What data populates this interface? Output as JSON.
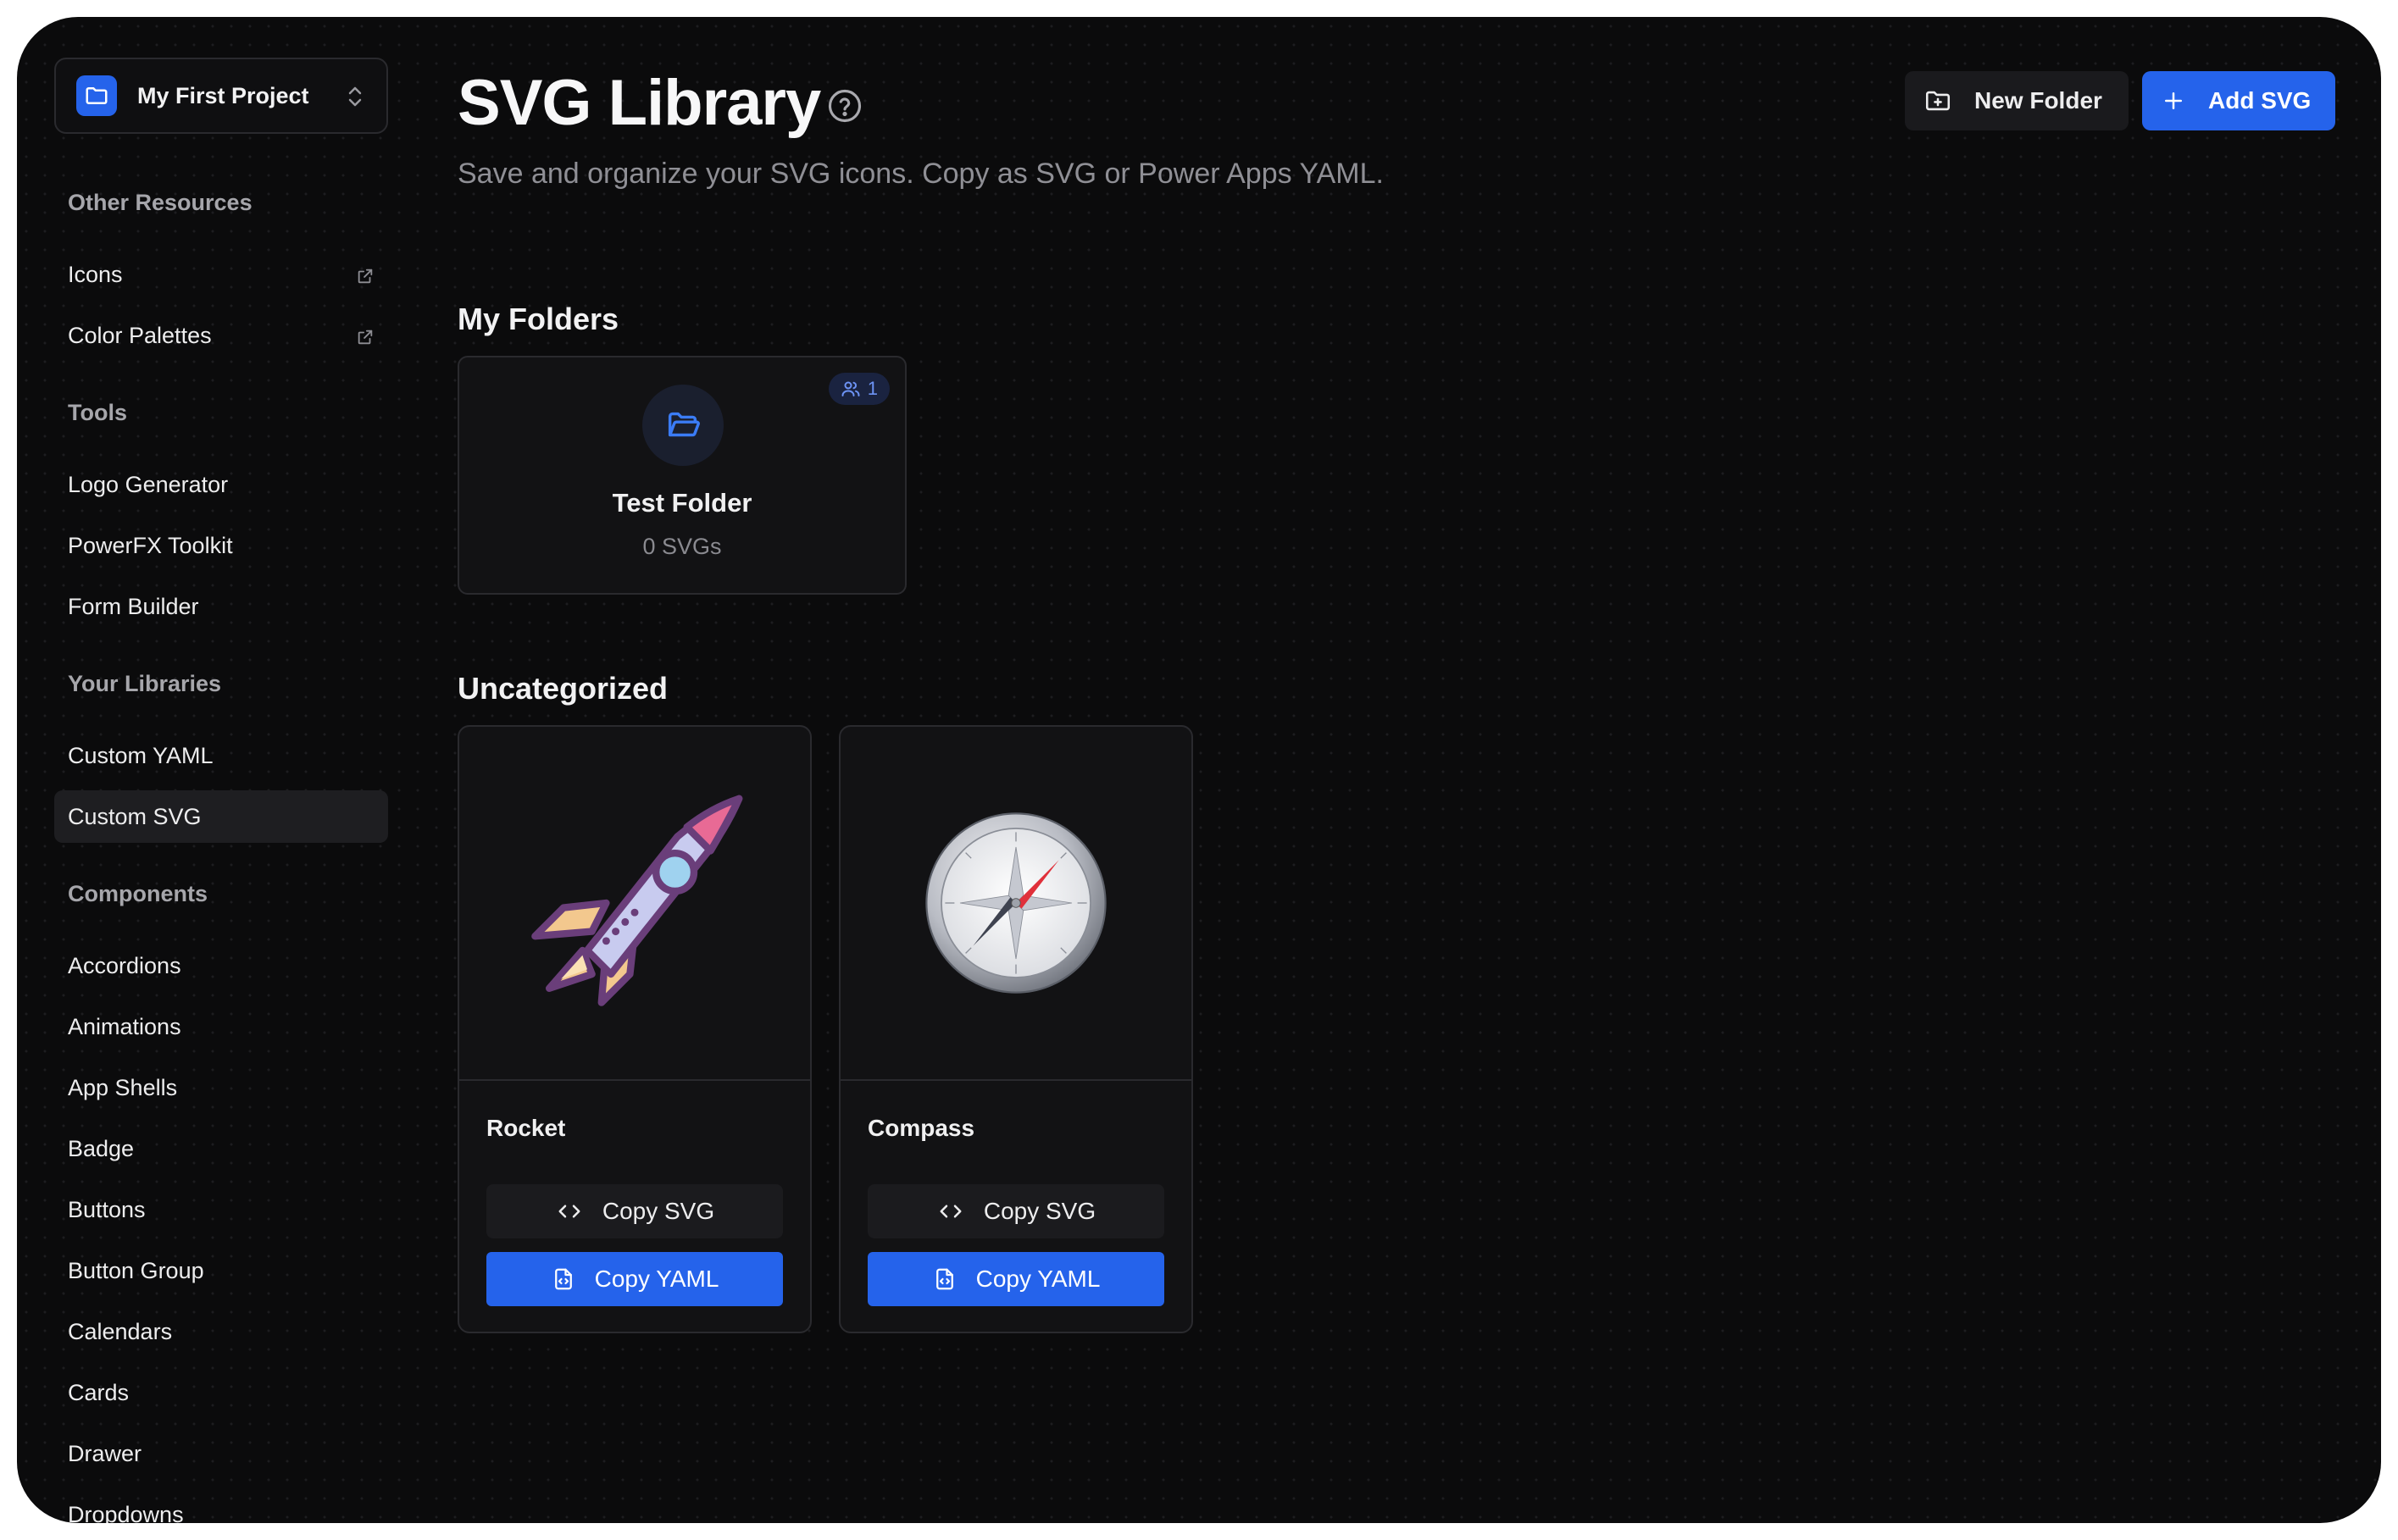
{
  "project": {
    "name": "My First Project"
  },
  "sidebar": {
    "sections": [
      {
        "heading": "Other Resources",
        "items": [
          {
            "label": "Icons",
            "external": true
          },
          {
            "label": "Color Palettes",
            "external": true
          }
        ]
      },
      {
        "heading": "Tools",
        "items": [
          {
            "label": "Logo Generator"
          },
          {
            "label": "PowerFX Toolkit"
          },
          {
            "label": "Form Builder"
          }
        ]
      },
      {
        "heading": "Your Libraries",
        "items": [
          {
            "label": "Custom YAML"
          },
          {
            "label": "Custom SVG",
            "active": true
          }
        ]
      },
      {
        "heading": "Components",
        "items": [
          {
            "label": "Accordions"
          },
          {
            "label": "Animations"
          },
          {
            "label": "App Shells"
          },
          {
            "label": "Badge"
          },
          {
            "label": "Buttons"
          },
          {
            "label": "Button Group"
          },
          {
            "label": "Calendars"
          },
          {
            "label": "Cards"
          },
          {
            "label": "Drawer"
          },
          {
            "label": "Dropdowns"
          }
        ]
      }
    ]
  },
  "header": {
    "title": "SVG Library",
    "subtitle": "Save and organize your SVG icons. Copy as SVG or Power Apps YAML.",
    "new_folder_label": "New Folder",
    "add_svg_label": "Add SVG"
  },
  "folders_section": {
    "title": "My Folders",
    "folders": [
      {
        "name": "Test Folder",
        "count": "0 SVGs",
        "shared_count": "1"
      }
    ]
  },
  "uncategorized": {
    "title": "Uncategorized",
    "items": [
      {
        "name": "Rocket",
        "icon": "rocket-icon",
        "copy_svg_label": "Copy SVG",
        "copy_yaml_label": "Copy YAML"
      },
      {
        "name": "Compass",
        "icon": "compass-icon",
        "copy_svg_label": "Copy SVG",
        "copy_yaml_label": "Copy YAML"
      }
    ]
  },
  "colors": {
    "accent": "#2563eb",
    "background": "#0b0b0c",
    "card": "#121214",
    "border": "#2a2a2e"
  }
}
